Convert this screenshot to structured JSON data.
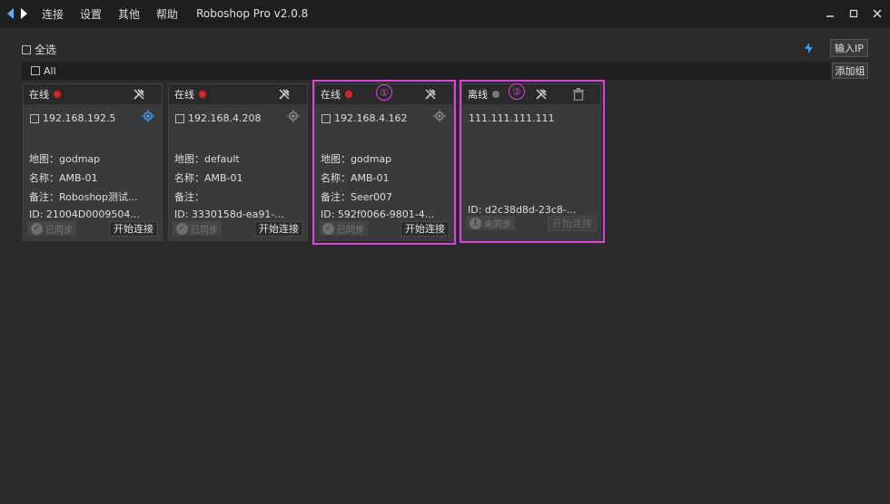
{
  "titlebar": {
    "menu": [
      "连接",
      "设置",
      "其他",
      "帮助"
    ],
    "app_title": "Roboshop Pro v2.0.8"
  },
  "toolbar": {
    "select_all_label": "全选",
    "input_ip_label": "输入IP",
    "add_group_label": "添加组"
  },
  "group": {
    "all_label": "All"
  },
  "cards": [
    {
      "status": "在线",
      "status_color": "#e02020",
      "ip": "192.168.192.5",
      "map": "地图：godmap",
      "name": "名称：AMB-01",
      "note": "备注：Roboshop测试...",
      "id": "ID: 21004D0009504...",
      "sync": "已同步",
      "connect": "开始连接"
    },
    {
      "status": "在线",
      "status_color": "#e02020",
      "ip": "192.168.4.208",
      "map": "地图：default",
      "name": "名称：AMB-01",
      "note": "备注：",
      "id": "ID: 3330158d-ea91-...",
      "sync": "已同步",
      "connect": "开始连接"
    },
    {
      "status": "在线",
      "status_color": "#e02020",
      "ip": "192.168.4.162",
      "map": "地图：godmap",
      "name": "名称：AMB-01",
      "note": "备注：Seer007",
      "id": "ID: 592f0066-9801-4...",
      "sync": "已同步",
      "connect": "开始连接",
      "marker": "①"
    },
    {
      "status": "离线",
      "status_color": "#7a7a7a",
      "ip": "111.111.111.111",
      "id": "ID: d2c38d8d-23c8-...",
      "sync": "未同步",
      "connect": "开始连接",
      "marker": "②"
    }
  ]
}
